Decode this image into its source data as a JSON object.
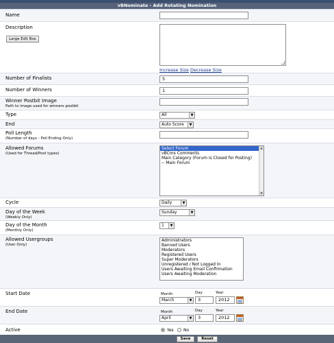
{
  "header": {
    "title": "vBNominate - Add Rotating Nomination"
  },
  "fields": {
    "name": {
      "label": "Name",
      "value": ""
    },
    "description": {
      "label": "Description",
      "large_edit_label": "Large Edit Box",
      "increase_size": "Increase Size",
      "decrease_size": "Decrease Size"
    },
    "finalists": {
      "label": "Number of Finalists",
      "value": "5"
    },
    "winners": {
      "label": "Number of Winners",
      "value": "1"
    },
    "postbit": {
      "label": "Winner Postbit Image",
      "sublabel": "Path to image used for winners postbit",
      "value": ""
    },
    "type": {
      "label": "Type",
      "selected": "All"
    },
    "end": {
      "label": "End",
      "selected": "Auto Score"
    },
    "poll_length": {
      "label": "Poll Length",
      "sublabel": "(Number of days - Poll Ending Only)",
      "value": ""
    },
    "allowed_forums": {
      "label": "Allowed Forums",
      "sublabel": "(Used for Thread/Post types)",
      "options": [
        "Select Forum",
        "vBCms Comments",
        "Main Category (Forum is Closed for Posting)",
        "-- Main Forum"
      ],
      "selected_index": 0
    },
    "cycle": {
      "label": "Cycle",
      "selected": "Daily"
    },
    "day_of_week": {
      "label": "Day of the Week",
      "sublabel": "(Weekly Only)",
      "selected": "Sunday"
    },
    "day_of_month": {
      "label": "Day of the Month",
      "sublabel": "(Monthly Only)",
      "selected": "1"
    },
    "allowed_usergroups": {
      "label": "Allowed Usergroups",
      "sublabel": "(User Only)",
      "options": [
        "Administrators",
        "Banned Users",
        "Moderators",
        "Registered Users",
        "Super Moderators",
        "Unregistered / Not Logged In",
        "Users Awaiting Email Confirmation",
        "Users Awaiting Moderation"
      ]
    },
    "start_date": {
      "label": "Start Date",
      "month_label": "Month",
      "day_label": "Day",
      "year_label": "Year",
      "month": "March",
      "day": "3",
      "year": "2012"
    },
    "end_date": {
      "label": "End Date",
      "month_label": "Month",
      "day_label": "Day",
      "year_label": "Year",
      "month": "April",
      "day": "3",
      "year": "2012"
    },
    "active": {
      "label": "Active",
      "yes": "Yes",
      "no": "No",
      "value": "yes"
    }
  },
  "buttons": {
    "save": "Save",
    "reset": "Reset"
  },
  "colors": {
    "title_bg": "#56627a",
    "row_alt": "#f3f5f8",
    "selection": "#3366cc",
    "link": "#1a3c8c"
  }
}
